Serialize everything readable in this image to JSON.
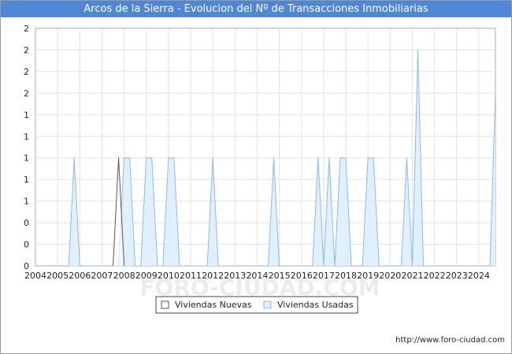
{
  "chart_data": {
    "type": "area",
    "title": "Arcos de la Sierra - Evolucion del Nº de Transacciones Inmobiliarias",
    "xlabel": "",
    "ylabel": "",
    "x_tick_labels": [
      "2004",
      "2005",
      "2006",
      "2007",
      "2008",
      "2009",
      "2010",
      "2011",
      "2012",
      "2013",
      "2014",
      "2015",
      "2016",
      "2017",
      "2018",
      "2019",
      "2020",
      "2021",
      "2022",
      "2023",
      "2024"
    ],
    "y_tick_labels": [
      "0",
      "0",
      "0",
      "1",
      "1",
      "1",
      "1",
      "1",
      "2",
      "2",
      "2",
      "2"
    ],
    "ylim": [
      0,
      2.2
    ],
    "xlim": [
      2004,
      2024.75
    ],
    "grid": true,
    "legend_position": "bottom",
    "series": [
      {
        "name": "Viviendas Nuevas",
        "fill": "#ffffff",
        "stroke": "#555555",
        "points": [
          [
            2007.5,
            0
          ],
          [
            2007.75,
            1
          ],
          [
            2008.0,
            0
          ]
        ]
      },
      {
        "name": "Viviendas Usadas",
        "fill": "#ddeeff",
        "stroke": "#8db9ea",
        "points": [
          [
            2005.5,
            0
          ],
          [
            2005.75,
            1
          ],
          [
            2006.0,
            0
          ],
          [
            2007.75,
            0
          ],
          [
            2008.0,
            1
          ],
          [
            2008.25,
            1
          ],
          [
            2008.5,
            0
          ],
          [
            2008.75,
            0
          ],
          [
            2009.0,
            1
          ],
          [
            2009.25,
            1
          ],
          [
            2009.5,
            0
          ],
          [
            2009.75,
            0
          ],
          [
            2010.0,
            1
          ],
          [
            2010.25,
            1
          ],
          [
            2010.5,
            0
          ],
          [
            2011.75,
            0
          ],
          [
            2012.0,
            1
          ],
          [
            2012.25,
            0
          ],
          [
            2014.5,
            0
          ],
          [
            2014.75,
            1
          ],
          [
            2015.0,
            0
          ],
          [
            2016.5,
            0
          ],
          [
            2016.75,
            1
          ],
          [
            2017.0,
            0
          ],
          [
            2017.25,
            1
          ],
          [
            2017.5,
            0
          ],
          [
            2017.75,
            1
          ],
          [
            2018.0,
            1
          ],
          [
            2018.25,
            0
          ],
          [
            2018.75,
            0
          ],
          [
            2019.0,
            1
          ],
          [
            2019.25,
            1
          ],
          [
            2019.5,
            0
          ],
          [
            2020.5,
            0
          ],
          [
            2020.75,
            1
          ],
          [
            2021.0,
            0
          ],
          [
            2021.25,
            2
          ],
          [
            2021.5,
            0
          ],
          [
            2024.5,
            0
          ],
          [
            2024.75,
            1.6
          ]
        ]
      }
    ]
  },
  "footer_url": "http://www.foro-ciudad.com",
  "watermark": "FORO-CIUDAD.COM"
}
